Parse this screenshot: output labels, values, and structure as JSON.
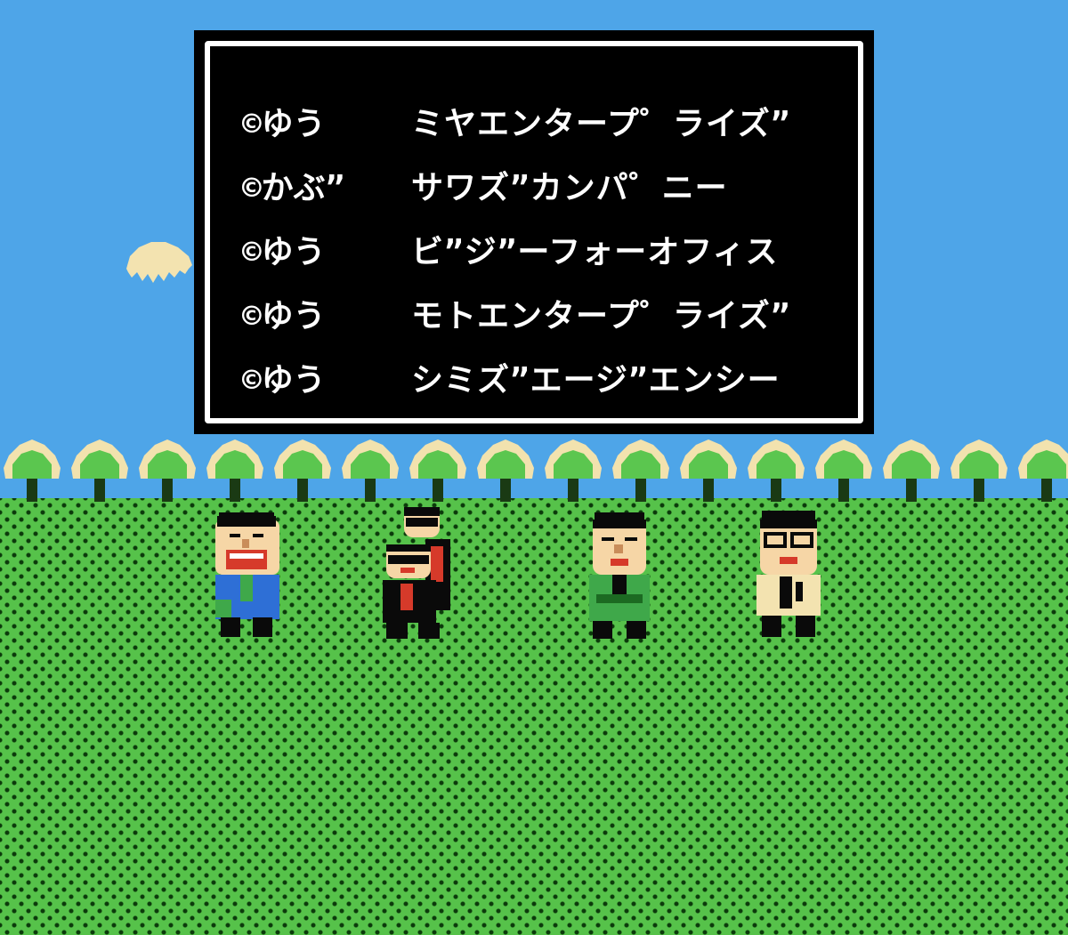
{
  "credits": [
    {
      "copyright": "©ゆう",
      "company": "ミヤエンタープ゜ライズ”"
    },
    {
      "copyright": "©かぶ”",
      "company": "サワズ”カンパ゜ニー"
    },
    {
      "copyright": "©ゆう",
      "company": "ビ”ジ”ーフォーオフィス"
    },
    {
      "copyright": "©ゆう",
      "company": "モトエンタープ゜ライズ”"
    },
    {
      "copyright": "©ゆう",
      "company": "シミズ”エージ”エンシー"
    }
  ],
  "colors": {
    "sky": "#4ea5e8",
    "grass": "#56c24a",
    "grass_dot": "#0b3a0b",
    "box_bg": "#000000",
    "box_border": "#ffffff",
    "cloud": "#f3e3b0",
    "tree_foliage": "#f2e2ae",
    "tree_leaf": "#5bc64f",
    "tree_trunk": "#1a3a14",
    "skin": "#f6d6a6",
    "blue_suit": "#2e6fd6",
    "green_suit": "#3fa84a",
    "red": "#d63a2a",
    "black": "#0a0a0a"
  },
  "characters": [
    {
      "name": "man-blue-suit"
    },
    {
      "name": "duo-black-suits"
    },
    {
      "name": "man-green-suit"
    },
    {
      "name": "man-glasses-cream"
    }
  ]
}
